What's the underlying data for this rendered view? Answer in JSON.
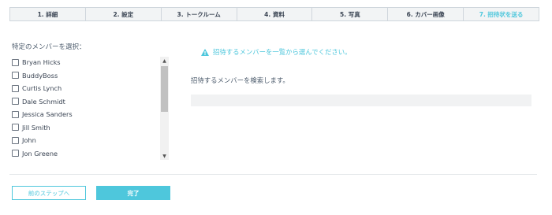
{
  "steps": [
    {
      "label": "1. 詳細",
      "active": false
    },
    {
      "label": "2. 設定",
      "active": false
    },
    {
      "label": "3. トークルーム",
      "active": false
    },
    {
      "label": "4. 資料",
      "active": false
    },
    {
      "label": "5. 写真",
      "active": false
    },
    {
      "label": "6. カバー画像",
      "active": false
    },
    {
      "label": "7. 招待状を送る",
      "active": true
    }
  ],
  "members_panel": {
    "label": "特定のメンバーを選択：",
    "members": [
      {
        "name": "Bryan Hicks",
        "checked": false
      },
      {
        "name": "BuddyBoss",
        "checked": false
      },
      {
        "name": "Curtis Lynch",
        "checked": false
      },
      {
        "name": "Dale Schmidt",
        "checked": false
      },
      {
        "name": "Jessica Sanders",
        "checked": false
      },
      {
        "name": "Jill Smith",
        "checked": false
      },
      {
        "name": "John",
        "checked": false
      },
      {
        "name": "Jon Greene",
        "checked": false
      }
    ]
  },
  "notice": {
    "text": "招待するメンバーを一覧から選んでください。",
    "icon": "warning-icon",
    "color": "#4ec7dc"
  },
  "search": {
    "label": "招待するメンバーを検索します。",
    "value": "",
    "placeholder": ""
  },
  "buttons": {
    "prev": "前のステップへ",
    "done": "完了"
  },
  "colors": {
    "accent": "#4ec7dc"
  }
}
